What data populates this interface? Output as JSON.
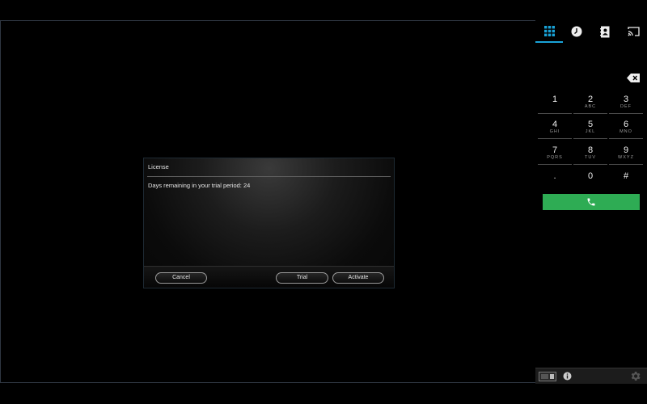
{
  "dialog": {
    "title": "License",
    "message": "Days remaining in your trial period: 24",
    "buttons": {
      "cancel": "Cancel",
      "trial": "Trial",
      "activate": "Activate"
    }
  },
  "sidebar": {
    "tabs": [
      {
        "icon": "dialpad-icon",
        "active": true
      },
      {
        "icon": "history-clock-icon",
        "active": false
      },
      {
        "icon": "contacts-icon",
        "active": false
      },
      {
        "icon": "cast-icon",
        "active": false
      }
    ],
    "keys": [
      {
        "digit": "1",
        "letters": ""
      },
      {
        "digit": "2",
        "letters": "ABC"
      },
      {
        "digit": "3",
        "letters": "DEF"
      },
      {
        "digit": "4",
        "letters": "GHI"
      },
      {
        "digit": "5",
        "letters": "JKL"
      },
      {
        "digit": "6",
        "letters": "MNO"
      },
      {
        "digit": "7",
        "letters": "PQRS"
      },
      {
        "digit": "8",
        "letters": "TUV"
      },
      {
        "digit": "9",
        "letters": "WXYZ"
      },
      {
        "digit": ".",
        "letters": ""
      },
      {
        "digit": "0",
        "letters": ""
      },
      {
        "digit": "#",
        "letters": ""
      }
    ]
  },
  "colors": {
    "accent": "#19a3d8",
    "call": "#2eac54",
    "background": "#000000"
  }
}
